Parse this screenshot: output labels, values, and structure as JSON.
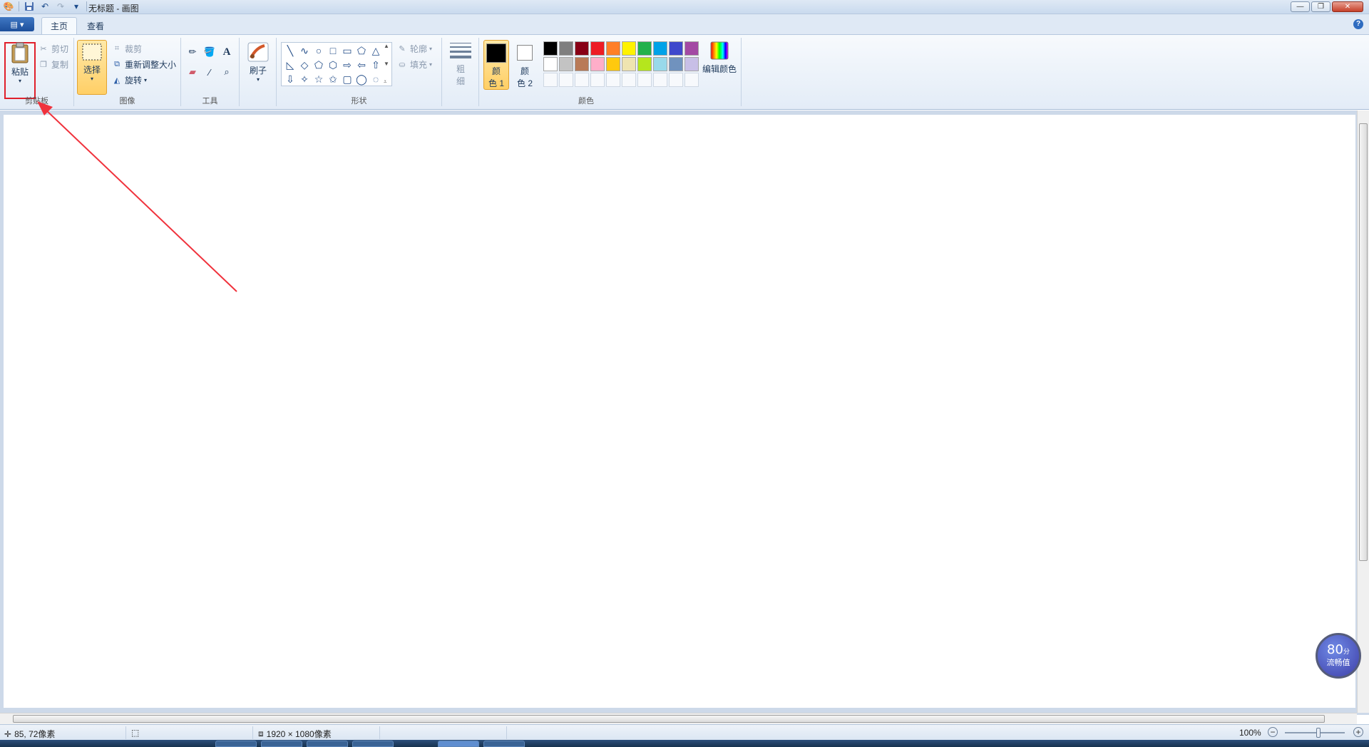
{
  "window": {
    "title": "无标题 - 画图",
    "buttons": {
      "minimize": "—",
      "maximize": "❐",
      "close": "✕"
    }
  },
  "qat": {
    "save_icon": "save-icon",
    "undo_icon": "undo-icon",
    "redo_icon": "redo-icon",
    "more": "▾"
  },
  "tabs": {
    "app_menu": "▤ ▾",
    "home": "主页",
    "view": "查看",
    "help": "?"
  },
  "clipboard": {
    "label": "剪贴板",
    "paste": "粘贴",
    "cut": "剪切",
    "copy": "复制"
  },
  "image": {
    "label": "图像",
    "select": "选择",
    "crop": "裁剪",
    "resize": "重新调整大小",
    "rotate": "旋转"
  },
  "tools": {
    "label": "工具"
  },
  "brushes": {
    "label": "刷子"
  },
  "shapes": {
    "label": "形状",
    "outline": "轮廓",
    "fill": "填充",
    "glyphs": [
      "╲",
      "∿",
      "○",
      "□",
      "▭",
      "⬠",
      "△",
      "◺",
      "◇",
      "⬠",
      "⬡",
      "⇨",
      "⇦",
      "⇧",
      "⇩",
      "✧",
      "☆",
      "✩",
      "▢",
      "◯",
      "◌"
    ]
  },
  "size": {
    "line1": "粗",
    "line2": "细"
  },
  "colors": {
    "label": "颜色",
    "color1_line1": "颜",
    "color1_line2": "色 1",
    "color1_value": "#000000",
    "color2_line1": "颜",
    "color2_line2": "色 2",
    "color2_value": "#ffffff",
    "edit": "编辑颜色",
    "palette_row1": [
      "#000000",
      "#7f7f7f",
      "#880015",
      "#ed1c24",
      "#ff7f27",
      "#fff200",
      "#22b14c",
      "#00a2e8",
      "#3f48cc",
      "#a349a4"
    ],
    "palette_row2": [
      "#ffffff",
      "#c3c3c3",
      "#b97a57",
      "#ffaec9",
      "#ffc90e",
      "#efe4b0",
      "#b5e61d",
      "#99d9ea",
      "#7092be",
      "#c8bfe7"
    ]
  },
  "status": {
    "cursor_pos": "85, 72像素",
    "image_size": "1920 × 1080像素",
    "zoom": "100%"
  },
  "badge": {
    "score": "80",
    "unit": "分",
    "label": "流畅值"
  }
}
